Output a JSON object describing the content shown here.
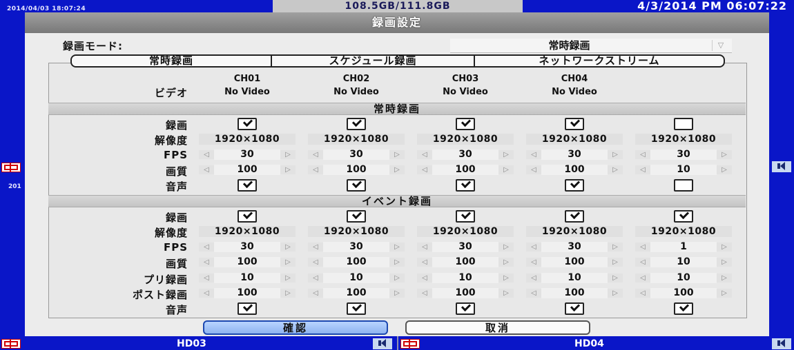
{
  "status_bar": {
    "timestamp_top_left": "2014/04/03 18:07:24",
    "timestamp_mid_left": "201",
    "disk_usage": "108.5GB/111.8GB",
    "datetime": "4/3/2014 PM 06:07:22"
  },
  "camera_labels": {
    "bottom_left": "HD03",
    "bottom_right": "HD04"
  },
  "dialog": {
    "title": "録画設定",
    "mode_label": "録画モード:",
    "mode_value": "常時録画",
    "tabs": [
      "常時録画",
      "スケジュール録画",
      "ネットワークストリーム"
    ],
    "video_label": "ビデオ",
    "channels": [
      {
        "name": "CH01",
        "status": "No Video"
      },
      {
        "name": "CH02",
        "status": "No Video"
      },
      {
        "name": "CH03",
        "status": "No Video"
      },
      {
        "name": "CH04",
        "status": "No Video"
      }
    ],
    "continuous_section": {
      "title": "常時録画",
      "labels": {
        "record": "録画",
        "resolution": "解像度",
        "fps": "FPS",
        "quality": "画質",
        "audio": "音声"
      },
      "columns": [
        {
          "record": true,
          "resolution": "1920×1080",
          "fps": "30",
          "quality": "100",
          "audio": true
        },
        {
          "record": true,
          "resolution": "1920×1080",
          "fps": "30",
          "quality": "100",
          "audio": true
        },
        {
          "record": true,
          "resolution": "1920×1080",
          "fps": "30",
          "quality": "100",
          "audio": true
        },
        {
          "record": true,
          "resolution": "1920×1080",
          "fps": "30",
          "quality": "100",
          "audio": true
        },
        {
          "record": false,
          "resolution": "1920×1080",
          "fps": "30",
          "quality": "10",
          "audio": false
        }
      ]
    },
    "event_section": {
      "title": "イベント録画",
      "labels": {
        "record": "録画",
        "resolution": "解像度",
        "fps": "FPS",
        "quality": "画質",
        "pre_record": "プリ録画",
        "post_record": "ポスト録画",
        "audio": "音声"
      },
      "columns": [
        {
          "record": true,
          "resolution": "1920×1080",
          "fps": "30",
          "quality": "100",
          "pre_record": "10",
          "post_record": "100",
          "audio": true
        },
        {
          "record": true,
          "resolution": "1920×1080",
          "fps": "30",
          "quality": "100",
          "pre_record": "10",
          "post_record": "100",
          "audio": true
        },
        {
          "record": true,
          "resolution": "1920×1080",
          "fps": "30",
          "quality": "100",
          "pre_record": "10",
          "post_record": "100",
          "audio": true
        },
        {
          "record": true,
          "resolution": "1920×1080",
          "fps": "30",
          "quality": "100",
          "pre_record": "10",
          "post_record": "100",
          "audio": true
        },
        {
          "record": true,
          "resolution": "1920×1080",
          "fps": "1",
          "quality": "10",
          "pre_record": "10",
          "post_record": "100",
          "audio": true
        }
      ]
    },
    "spin_glyphs": {
      "decrease": "◁",
      "increase": "▷"
    },
    "dropdown_glyph": "▽",
    "buttons": {
      "ok": "確認",
      "cancel": "取消"
    }
  },
  "icons": [
    "camera-icon",
    "speaker-icon",
    "checkbox",
    "checkmark",
    "spin-left-arrow",
    "spin-right-arrow",
    "dropdown-arrow"
  ]
}
